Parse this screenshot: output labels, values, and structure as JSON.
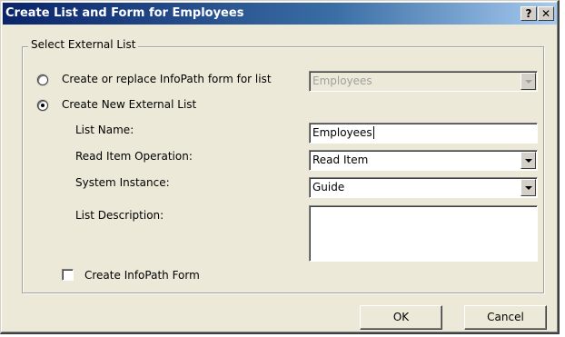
{
  "dialog": {
    "title": "Create List and Form for Employees",
    "help_glyph": "?",
    "close_glyph": "✕"
  },
  "group": {
    "legend": "Select External List",
    "radio_replace_label": "Create or replace InfoPath form for list",
    "existing_list_value": "Employees",
    "radio_new_label": "Create New External List",
    "selected_option": "Create New External List",
    "list_name_label": "List Name:",
    "list_name_value": "Employees",
    "read_item_label": "Read Item Operation:",
    "read_item_value": "Read Item",
    "system_instance_label": "System Instance:",
    "system_instance_value": "Guide",
    "list_description_label": "List Description:",
    "list_description_value": "",
    "create_form_label": "Create InfoPath Form",
    "create_form_checked": false
  },
  "buttons": {
    "ok": "OK",
    "cancel": "Cancel"
  }
}
